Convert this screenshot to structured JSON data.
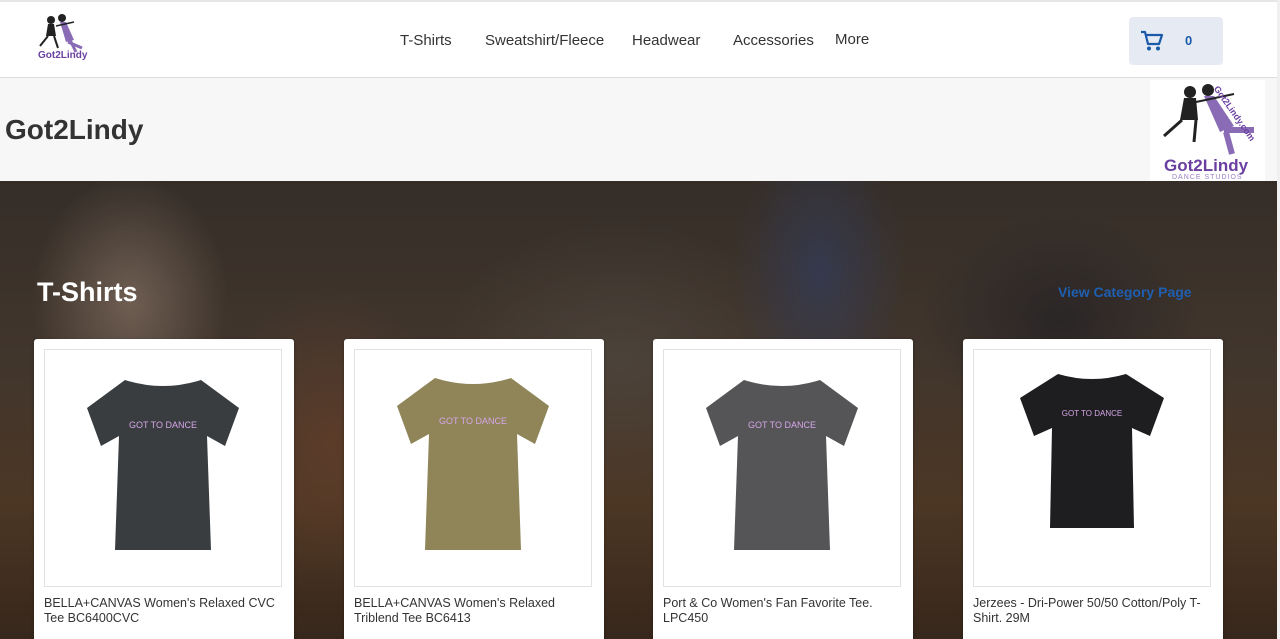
{
  "store": {
    "title": "Got2Lindy"
  },
  "logo": {
    "main": "Got2Lindy",
    "url_text": "Got2Lindy.com",
    "sub": "DANCE STUDIOS"
  },
  "nav": {
    "items": [
      {
        "label": "T-Shirts"
      },
      {
        "label": "Sweatshirt/Fleece"
      },
      {
        "label": "Headwear"
      },
      {
        "label": "Accessories"
      },
      {
        "label": "More"
      }
    ]
  },
  "cart": {
    "count": "0",
    "icon": "cart-icon"
  },
  "hero": {
    "title": "T-Shirts",
    "link": "View Category Page"
  },
  "products": [
    {
      "name": "BELLA+CANVAS Women's Relaxed CVC Tee BC6400CVC",
      "color": "#3a3d40",
      "print": "GOT TO DANCE"
    },
    {
      "name": "BELLA+CANVAS Women's Relaxed Triblend Tee BC6413",
      "color": "#8f8559",
      "print": "GOT TO DANCE"
    },
    {
      "name": "Port & Co Women's Fan Favorite Tee. LPC450",
      "color": "#555558",
      "print": "GOT TO DANCE"
    },
    {
      "name": "Jerzees - Dri-Power 50/50 Cotton/Poly T-Shirt. 29M",
      "color": "#1e1e20",
      "print": "GOT TO DANCE"
    }
  ],
  "colors": {
    "accent": "#1f5fb0",
    "cart_bg": "#e6ebf3",
    "print": "#d6a6e8"
  }
}
